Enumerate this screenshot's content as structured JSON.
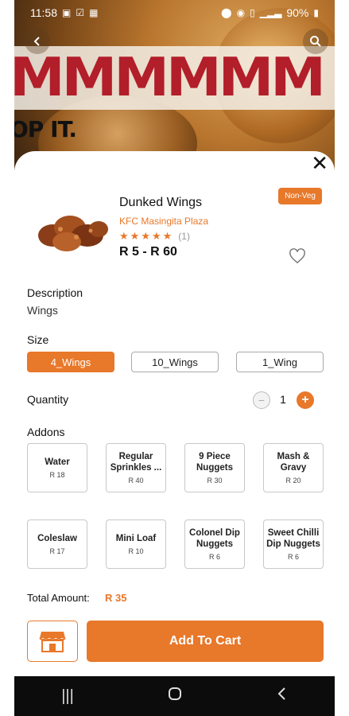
{
  "status_bar": {
    "time": "11:58",
    "battery": "90%"
  },
  "product": {
    "name": "Dunked Wings",
    "store": "KFC Masingita Plaza",
    "rating_count": "(1)",
    "rating": 5,
    "price_range": "R 5 - R 60",
    "badge": "Non-Veg"
  },
  "description": {
    "label": "Description",
    "text": "Wings"
  },
  "size": {
    "label": "Size",
    "options": [
      {
        "label": "4_Wings",
        "selected": true
      },
      {
        "label": "10_Wings",
        "selected": false
      },
      {
        "label": "1_Wing",
        "selected": false
      }
    ]
  },
  "quantity": {
    "label": "Quantity",
    "value": "1"
  },
  "addons": {
    "label": "Addons",
    "items": [
      {
        "name": "Water",
        "price": "R 18"
      },
      {
        "name": "Regular Sprinkles ...",
        "price": "R 40"
      },
      {
        "name": "9 Piece Nuggets",
        "price": "R 30"
      },
      {
        "name": "Mash & Gravy",
        "price": "R 20"
      },
      {
        "name": "Coleslaw",
        "price": "R 17"
      },
      {
        "name": "Mini Loaf",
        "price": "R 10"
      },
      {
        "name": "Colonel Dip Nuggets",
        "price": "R 6"
      },
      {
        "name": "Sweet Chilli Dip Nuggets",
        "price": "R 6"
      }
    ]
  },
  "total": {
    "label": "Total Amount:",
    "value": "R 35"
  },
  "actions": {
    "add_to_cart": "Add To Cart"
  },
  "hero": {
    "big_text": "MMMMMM",
    "small_text": "OP IT."
  },
  "colors": {
    "accent": "#e8782a"
  },
  "icons": [
    "back-icon",
    "search-icon",
    "close-icon",
    "heart-icon",
    "store-icon",
    "recents-icon",
    "home-icon",
    "nav-back-icon"
  ]
}
